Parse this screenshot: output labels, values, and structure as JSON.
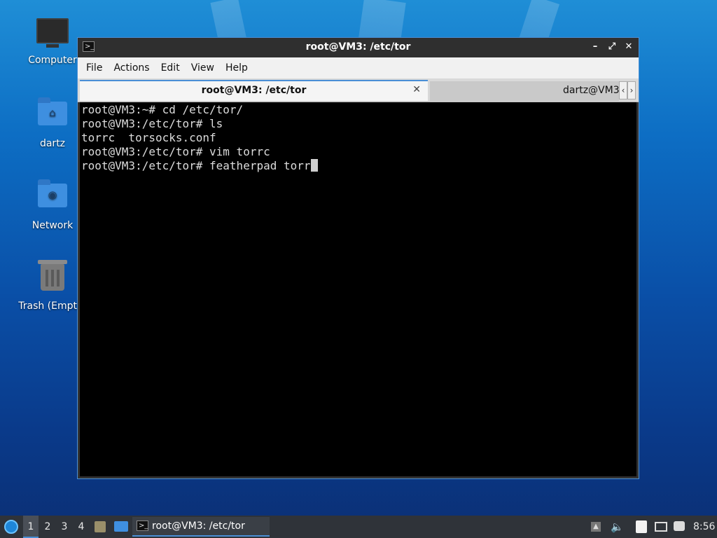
{
  "desktop": {
    "icons": [
      {
        "label": "Computer",
        "icon": "computer-icon"
      },
      {
        "label": "dartz",
        "icon": "home-folder-icon"
      },
      {
        "label": "Network",
        "icon": "network-folder-icon"
      },
      {
        "label": "Trash (Empty)",
        "icon": "trash-icon"
      }
    ]
  },
  "window": {
    "title": "root@VM3: /etc/tor",
    "menu": [
      "File",
      "Actions",
      "Edit",
      "View",
      "Help"
    ],
    "tabs": [
      {
        "label": "root@VM3: /etc/tor",
        "active": true
      },
      {
        "label": "dartz@VM3",
        "active": false
      }
    ]
  },
  "terminal": {
    "lines": [
      "root@VM3:~# cd /etc/tor/",
      "root@VM3:/etc/tor# ls",
      "torrc  torsocks.conf",
      "root@VM3:/etc/tor# vim torrc",
      "root@VM3:/etc/tor# featherpad torr"
    ]
  },
  "taskbar": {
    "workspaces": [
      "1",
      "2",
      "3",
      "4"
    ],
    "active_workspace": "1",
    "task_label": "root@VM3: /etc/tor",
    "clock": "8:56"
  },
  "colors": {
    "accent": "#4a8fd6",
    "terminal_bg": "#000000",
    "terminal_fg": "#dcdcdc",
    "taskbar_bg": "#2f3339"
  }
}
